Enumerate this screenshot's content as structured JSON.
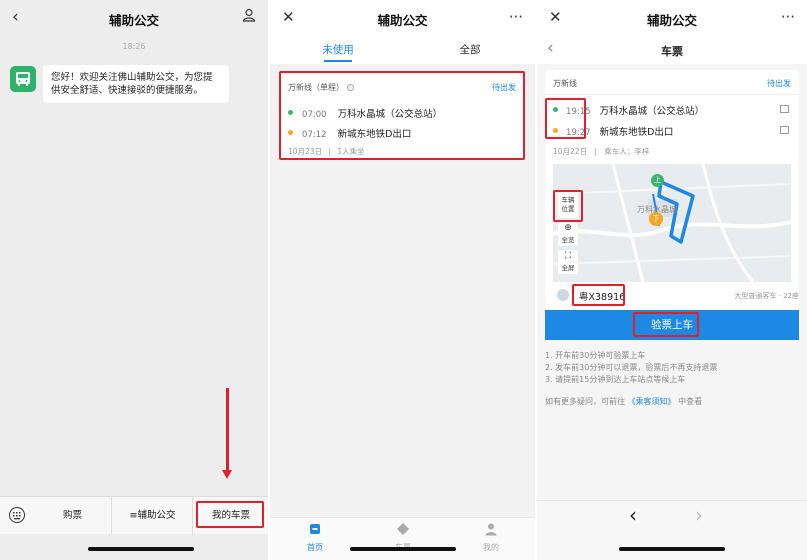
{
  "chat": {
    "back_icon": "chevron-left-icon",
    "title": "辅助公交",
    "profile_icon": "person-icon",
    "timestamp": "18:26",
    "avatar_icon": "bus-icon",
    "message": "您好！欢迎关注佛山辅助公交，为您提供安全舒适、快速接驳的便捷服务。",
    "bottom_menu": {
      "keyboard_icon": "keyboard-icon",
      "items": [
        "购票",
        "≡辅助公交",
        "我的车票"
      ]
    }
  },
  "tickets": {
    "close_icon": "close-icon",
    "title": "辅助公交",
    "more_icon": "more-icon",
    "tabs": [
      "未使用",
      "全部"
    ],
    "card": {
      "line": "万新线（单程）",
      "info_icon": "info-icon",
      "status": "待出发",
      "stops": [
        {
          "time": "07:00",
          "name": "万科水晶城（公交总站）"
        },
        {
          "time": "07:12",
          "name": "新城东地铁D出口"
        }
      ],
      "date": "10月23日",
      "separator": "|",
      "passengers": "1人乘坐"
    },
    "tabbar": [
      {
        "label": "首页",
        "icon": "home-icon"
      },
      {
        "label": "车票",
        "icon": "ticket-icon"
      },
      {
        "label": "我的",
        "icon": "user-icon"
      }
    ]
  },
  "detail": {
    "close_icon": "close-icon",
    "title": "辅助公交",
    "more_icon": "more-icon",
    "back_icon": "chevron-left-icon",
    "subtitle": "车票",
    "line": "万新线",
    "status": "待出发",
    "stops": [
      {
        "time": "19:15",
        "name": "万科水晶城（公交总站）"
      },
      {
        "time": "19:27",
        "name": "新城东地铁D出口"
      }
    ],
    "date": "10月22日",
    "separator": "|",
    "rider": "乘车人：李梓",
    "map": {
      "vehicle_pos": "车辆位置",
      "overview": "全览",
      "fullscreen": "全屏",
      "marker_on": "上",
      "marker_off": "下",
      "map_label": "万科水晶城"
    },
    "plate": "粤X38916",
    "vehicle_type": "大型普通客车 · 22座",
    "check_button": "验票上车",
    "rules": [
      "1. 开车前30分钟可验票上车",
      "2. 发车前30分钟可以退票，验票后不再支持退票",
      "3. 请提前15分钟到达上车站点等候上车"
    ],
    "faq_prefix": "如有更多疑问，可前往",
    "faq_link": "《乘客须知》",
    "faq_suffix": "中查看",
    "browser_back": "‹",
    "browser_forward": "›"
  },
  "colors": {
    "accent_blue": "#1e88e5",
    "highlight_red": "#e0202a",
    "green": "#3cb371",
    "orange": "#f5a623"
  }
}
